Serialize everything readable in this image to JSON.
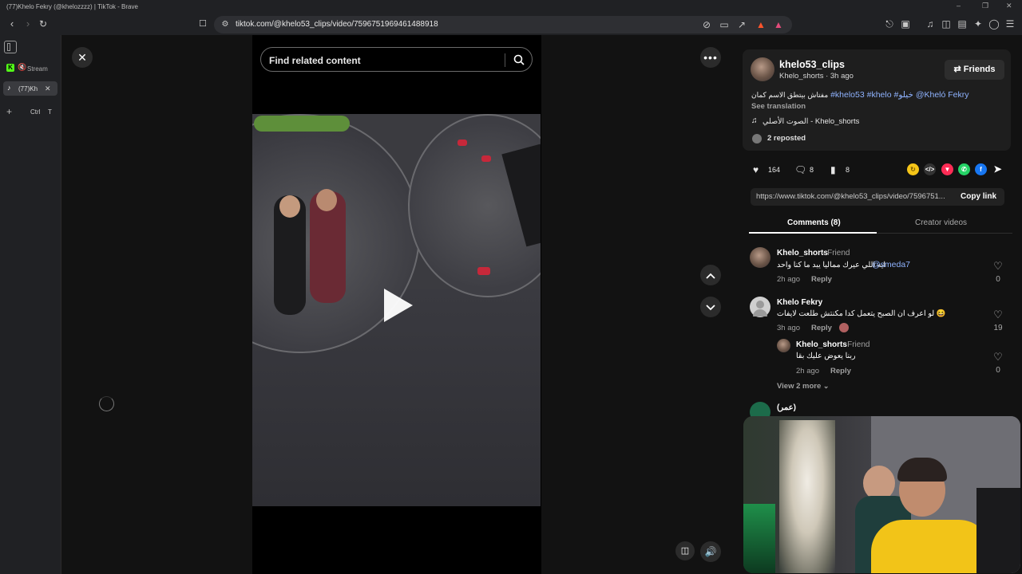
{
  "window": {
    "title": "(77)Khelo Fekry (@khelozzzz) | TikTok - Brave"
  },
  "browser": {
    "url": "tiktok.com/@khelo53_clips/video/7596751969461488918"
  },
  "sidebar": {
    "items": [
      {
        "label": "Stream"
      },
      {
        "label": "(77)Kh"
      }
    ],
    "shortcut": {
      "key1": "Ctrl",
      "key2": "T"
    }
  },
  "video": {
    "search_placeholder": "Find related content"
  },
  "post": {
    "username": "khelo53_clips",
    "subtitle": "Khelo_shorts · 3h ago",
    "friends_label": "Friends",
    "caption_text": "مفتاش بيتطق الاسم كمان",
    "hashtags": [
      "#khelo53",
      "#khelo",
      "#خيلو",
      "@Kheló Fekry"
    ],
    "see_translation": "See translation",
    "music": "الصوت الأصلي - Khelo_shorts",
    "reposted": "2 reposted",
    "likes": "164",
    "comments_count": "8",
    "saves": "8",
    "share_url": "https://www.tiktok.com/@khelo53_clips/video/7596751...",
    "copy_link": "Copy link"
  },
  "tabs": {
    "comments": "Comments (8)",
    "creator": "Creator videos"
  },
  "comments": [
    {
      "name": "Khelo_shorts",
      "badge": " · Friend",
      "text": "ايه اللي عيرك مماليا يبد ما كنا واحد",
      "mention": "@smeda7",
      "time": "2h ago",
      "reply": "Reply",
      "likes": "0"
    },
    {
      "name": "Khelo Fekry",
      "text": "لو اعرف ان الصبح يتعمل كدا مكنتش طلعت لايفات 😆",
      "time": "3h ago",
      "reply": "Reply",
      "likes": "19"
    },
    {
      "name": "Khelo_shorts",
      "badge": " · Friend",
      "text": "ربنا يعوض عليك بقا",
      "time": "2h ago",
      "reply": "Reply",
      "likes": "0"
    }
  ],
  "view_more": "View 2 more",
  "next_commenter": "(عمر)",
  "icons": {
    "close": "close-icon",
    "search": "search-icon",
    "more": "more-icon",
    "up": "chevron-up-icon",
    "down": "chevron-down-icon",
    "play": "play-icon",
    "volume": "volume-icon"
  }
}
